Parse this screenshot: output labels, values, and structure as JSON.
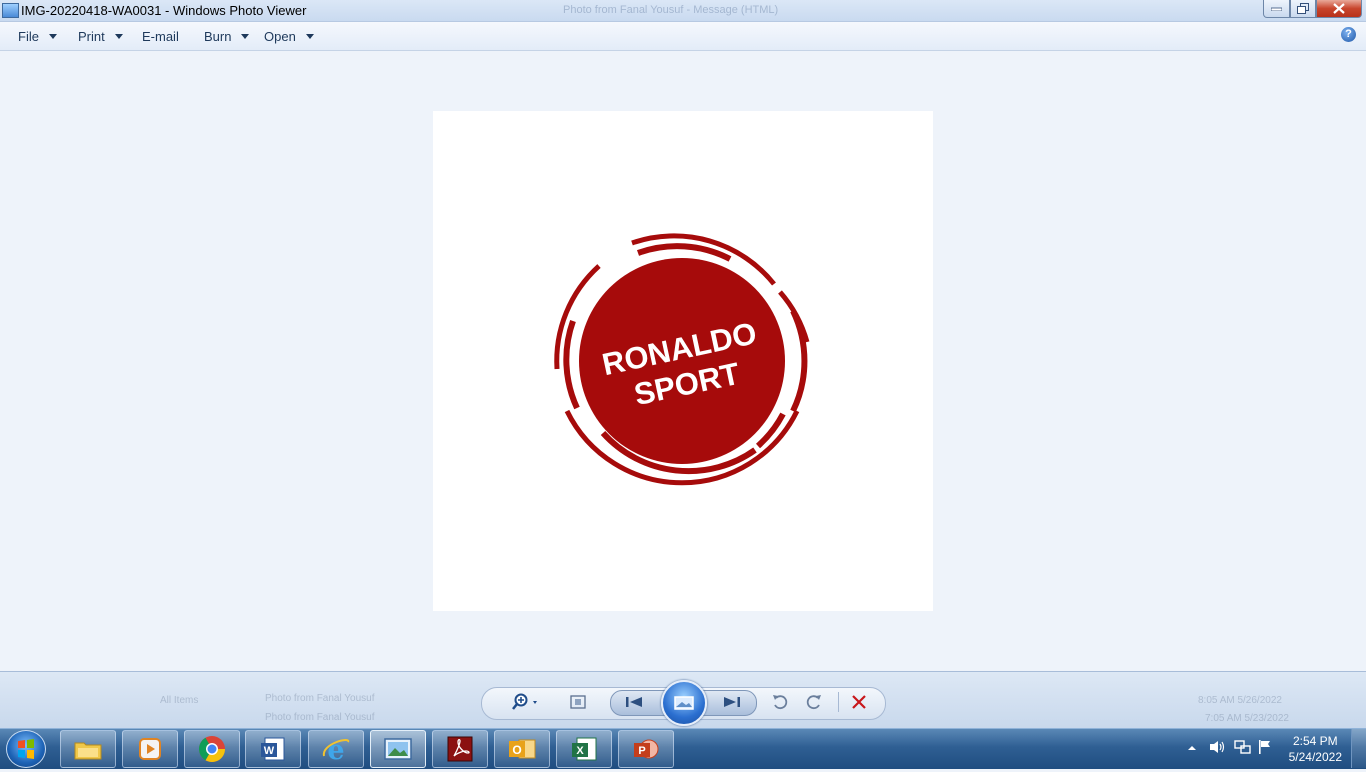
{
  "window": {
    "title": "IMG-20220418-WA0031 - Windows Photo Viewer",
    "background_title": "Photo from Fanal Yousuf - Message (HTML)"
  },
  "menu": {
    "file": "File",
    "print": "Print",
    "email": "E-mail",
    "burn": "Burn",
    "open": "Open",
    "help": "?"
  },
  "photo": {
    "line1": "RONALDO",
    "line2": "SPORT",
    "colors": {
      "logo": "#a60b0b",
      "background": "#ffffff"
    }
  },
  "background_window": {
    "all_items": "All Items",
    "row1": "Photo from Fanal Yousuf",
    "row2": "Photo from Fanal Yousuf",
    "time1": "8:05 AM 5/26/2022",
    "time2": "7:05 AM 5/23/2022"
  },
  "toolbar": {
    "zoom": "zoom-icon",
    "actual_size": "actual-size-icon",
    "previous": "previous-icon",
    "slideshow": "slideshow-icon",
    "next": "next-icon",
    "rotate_ccw": "rotate-left-icon",
    "rotate_cw": "rotate-right-icon",
    "delete": "delete-icon"
  },
  "taskbar": {
    "apps": [
      "Windows Explorer",
      "Windows Media Player",
      "Google Chrome",
      "Microsoft Word",
      "Internet Explorer",
      "Windows Photo Viewer",
      "Adobe Acrobat",
      "Microsoft Outlook",
      "Microsoft Excel",
      "Microsoft PowerPoint"
    ],
    "clock": {
      "time": "2:54 PM",
      "date": "5/24/2022"
    }
  }
}
